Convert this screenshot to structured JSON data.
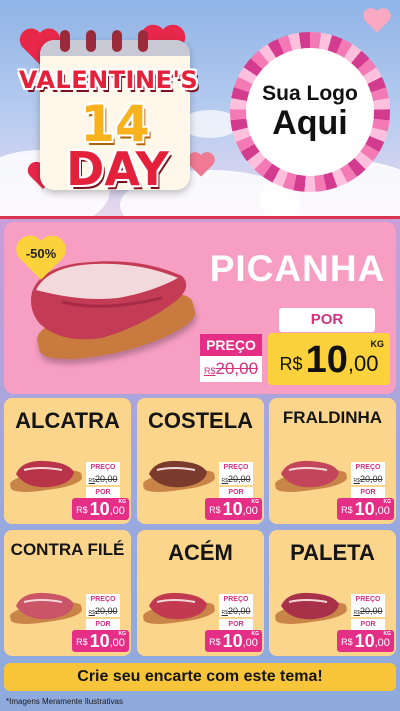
{
  "header": {
    "title_line1": "VALENTINE'S",
    "title_number": "14",
    "title_line2": "DAY",
    "logo_line1": "Sua Logo",
    "logo_line2": "Aqui"
  },
  "featured": {
    "discount": "-50%",
    "name": "PICANHA",
    "por_label": "POR",
    "preco_label": "PREÇO",
    "old_currency": "R$",
    "old_value": "20,00",
    "new_currency": "R$",
    "new_int": "10",
    "new_dec": ",00",
    "unit": "KG"
  },
  "products": [
    {
      "name": "ALCATRA",
      "preco_label": "PREÇO",
      "old_currency": "R$",
      "old_value": "20,00",
      "por_label": "POR",
      "currency": "R$",
      "int": "10",
      "dec": ",00",
      "unit": "KG"
    },
    {
      "name": "COSTELA",
      "preco_label": "PREÇO",
      "old_currency": "R$",
      "old_value": "20,00",
      "por_label": "POR",
      "currency": "R$",
      "int": "10",
      "dec": ",00",
      "unit": "KG"
    },
    {
      "name": "FRALDINHA",
      "preco_label": "PREÇO",
      "old_currency": "R$",
      "old_value": "20,00",
      "por_label": "POR",
      "currency": "R$",
      "int": "10",
      "dec": ",00",
      "unit": "KG"
    },
    {
      "name": "CONTRA FILÉ",
      "preco_label": "PREÇO",
      "old_currency": "R$",
      "old_value": "20,00",
      "por_label": "POR",
      "currency": "R$",
      "int": "10",
      "dec": ",00",
      "unit": "KG"
    },
    {
      "name": "ACÉM",
      "preco_label": "PREÇO",
      "old_currency": "R$",
      "old_value": "20,00",
      "por_label": "POR",
      "currency": "R$",
      "int": "10",
      "dec": ",00",
      "unit": "KG"
    },
    {
      "name": "PALETA",
      "preco_label": "PREÇO",
      "old_currency": "R$",
      "old_value": "20,00",
      "por_label": "POR",
      "currency": "R$",
      "int": "10",
      "dec": ",00",
      "unit": "KG"
    }
  ],
  "footer": {
    "cta": "Crie seu encarte com este tema!",
    "disclaimer": "*Imagens Meramente Ilustrativas"
  },
  "colors": {
    "accent_pink": "#e52f86",
    "price_yellow": "#fbd23c",
    "card_bg": "#fcd58d",
    "hero_bg": "#f79fc3",
    "title_red": "#e3213a"
  }
}
